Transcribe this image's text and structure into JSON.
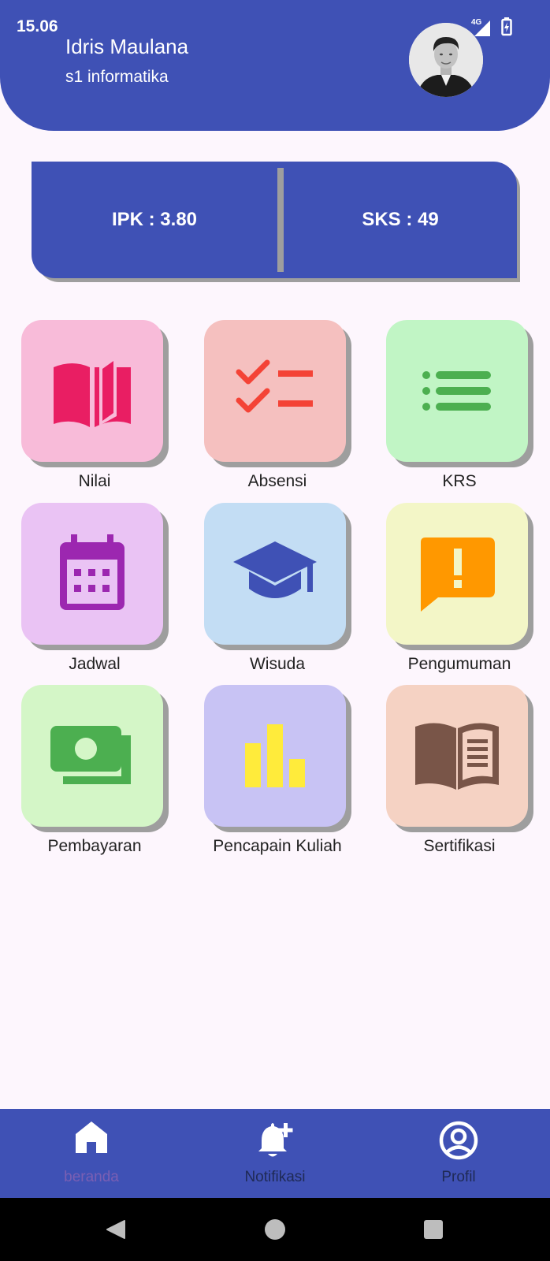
{
  "status_bar": {
    "time": "15.06",
    "network": "4G"
  },
  "header": {
    "name": "Idris Maulana",
    "program": "s1 informatika"
  },
  "stats": {
    "ipk": "IPK : 3.80",
    "sks": "SKS : 49"
  },
  "menu": [
    {
      "label": "Nilai",
      "icon": "open-book-icon",
      "bg": "#f8bbd9",
      "fg": "#e91e63"
    },
    {
      "label": "Absensi",
      "icon": "checklist-icon",
      "bg": "#f5c0bf",
      "fg": "#f44336"
    },
    {
      "label": "KRS",
      "icon": "list-icon",
      "bg": "#c1f5c5",
      "fg": "#4caf50"
    },
    {
      "label": "Jadwal",
      "icon": "calendar-icon",
      "bg": "#eac3f4",
      "fg": "#9c27b0"
    },
    {
      "label": "Wisuda",
      "icon": "graduation-cap-icon",
      "bg": "#c3ddf4",
      "fg": "#3f51b5"
    },
    {
      "label": "Pengumuman",
      "icon": "announcement-icon",
      "bg": "#f3f6c7",
      "fg": "#ff9800"
    },
    {
      "label": "Pembayaran",
      "icon": "money-icon",
      "bg": "#d4f6c7",
      "fg": "#4caf50"
    },
    {
      "label": "Pencapain Kuliah",
      "icon": "bar-chart-icon",
      "bg": "#c8c3f4",
      "fg": "#ffeb3b"
    },
    {
      "label": "Sertifikasi",
      "icon": "book-text-icon",
      "bg": "#f5d2c3",
      "fg": "#795548"
    }
  ],
  "bottom_nav": {
    "home": "beranda",
    "notifications": "Notifikasi",
    "profile": "Profil"
  },
  "colors": {
    "primary": "#3f51b5",
    "background": "#fdf6fd",
    "active_label": "#7b5fb3",
    "inactive_label": "#1f2a55"
  }
}
